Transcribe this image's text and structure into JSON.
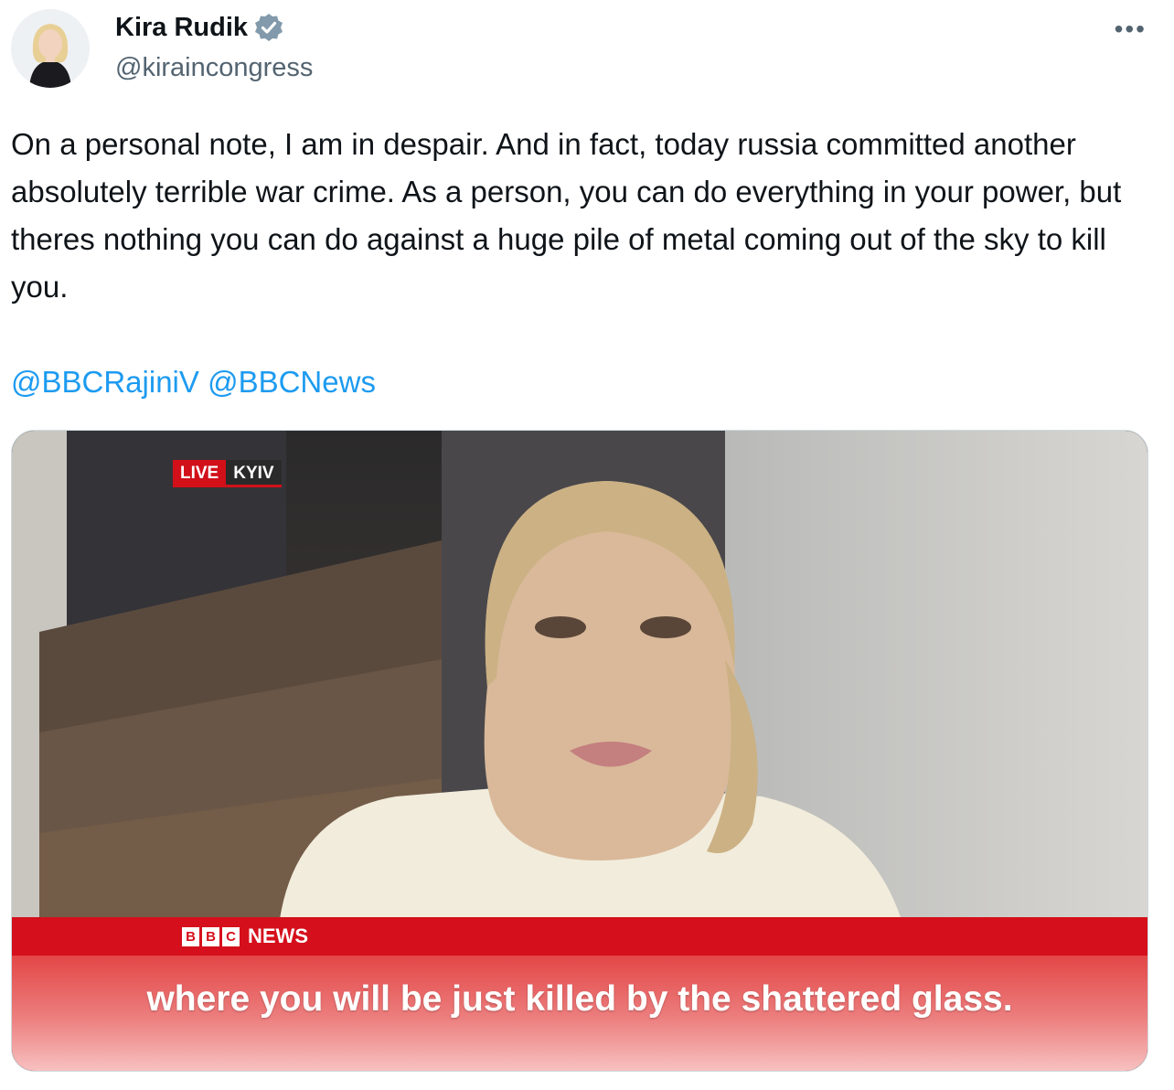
{
  "author": {
    "name": "Kira Rudik",
    "handle": "@kiraincongress",
    "verified": true
  },
  "tweet": {
    "text": "On a personal note, I am in despair. And in fact, today russia committed another absolutely terrible war crime. As a person, you can do everything in your power, but theres nothing you can do against a huge pile of metal coming out of the sky to kill you.",
    "mentions": [
      "@BBCRajiniV",
      "@BBCNews"
    ]
  },
  "media": {
    "live_label": "LIVE",
    "location_label": "KYIV",
    "bbc_letters": [
      "B",
      "B",
      "C"
    ],
    "news_label": "NEWS",
    "subtitle": "where you will be just killed by the shattered glass."
  },
  "icons": {
    "more": "more-horizontal-icon",
    "verified": "verified-badge-icon"
  },
  "colors": {
    "link": "#1d9bf0",
    "secondary_text": "#536471",
    "bbc_red": "#d50f1b"
  }
}
